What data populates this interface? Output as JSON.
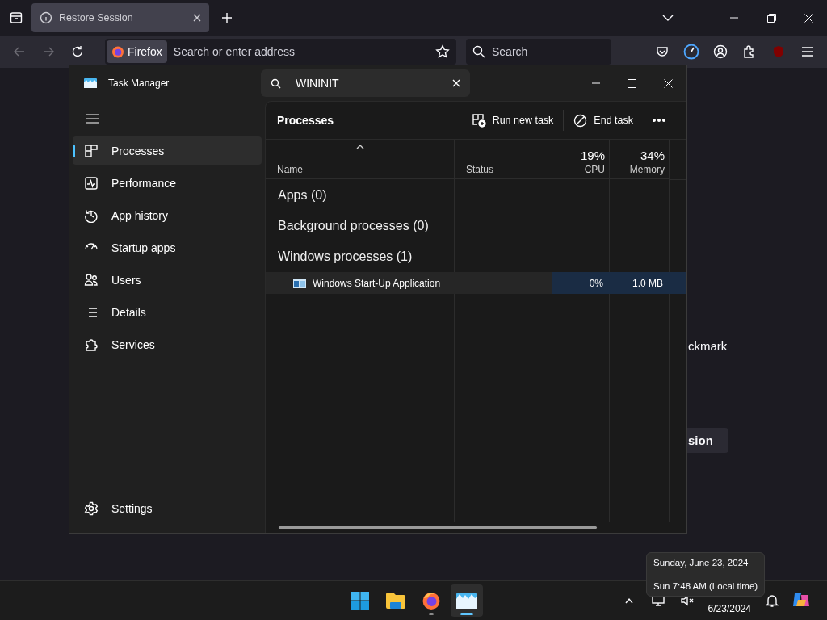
{
  "browser": {
    "tabs": [
      {
        "label": "Restore Session",
        "selected": true
      }
    ],
    "nav_buttons": [
      {
        "kind": "back",
        "disabled": true
      },
      {
        "kind": "forward",
        "disabled": true
      },
      {
        "kind": "reload",
        "disabled": false
      }
    ],
    "address_bar": {
      "identity": "Firefox",
      "placeholder": "Search or enter address"
    },
    "search_bar": {
      "placeholder": "Search"
    }
  },
  "page": {
    "text": "ckmark",
    "button": "sion"
  },
  "task_manager": {
    "title": "Task Manager",
    "search": {
      "value": "WININIT"
    },
    "nav": [
      {
        "kind": "processes",
        "label": "Processes",
        "selected": true
      },
      {
        "kind": "performance",
        "label": "Performance",
        "selected": false
      },
      {
        "kind": "app_history",
        "label": "App history",
        "selected": false
      },
      {
        "kind": "startup",
        "label": "Startup apps",
        "selected": false
      },
      {
        "kind": "users",
        "label": "Users",
        "selected": false
      },
      {
        "kind": "details",
        "label": "Details",
        "selected": false
      },
      {
        "kind": "services",
        "label": "Services",
        "selected": false
      }
    ],
    "settings": "Settings",
    "section_title": "Processes",
    "actions": [
      {
        "kind": "run",
        "label": "Run new task"
      },
      {
        "kind": "end",
        "label": "End task"
      }
    ],
    "columns": [
      {
        "kind": "text",
        "label": "Name",
        "sorted": true
      },
      {
        "kind": "text",
        "label": "Status",
        "sorted": false
      },
      {
        "kind": "metric",
        "label": "CPU",
        "usage": "19%",
        "sorted": false
      },
      {
        "kind": "metric",
        "label": "Memory",
        "usage": "34%",
        "sorted": false
      }
    ],
    "rows": [
      {
        "kind": "group",
        "name": "Apps (0)"
      },
      {
        "kind": "group",
        "name": "Background processes (0)"
      },
      {
        "kind": "group",
        "name": "Windows processes (1)"
      },
      {
        "kind": "process",
        "name": "Windows Start-Up Application",
        "cpu": "0%",
        "memory": "1.0 MB"
      }
    ]
  },
  "taskbar": {
    "apps": [
      {
        "kind": "start",
        "selected": false,
        "running": false
      },
      {
        "kind": "explorer",
        "selected": false,
        "running": false
      },
      {
        "kind": "firefox",
        "selected": false,
        "running": true
      },
      {
        "kind": "taskmanager",
        "selected": true,
        "running": true
      }
    ],
    "date": "6/23/2024"
  },
  "tooltip": {
    "lines": [
      "Sunday, June 23, 2024",
      "Sun 7:48 AM (Local time)"
    ]
  }
}
